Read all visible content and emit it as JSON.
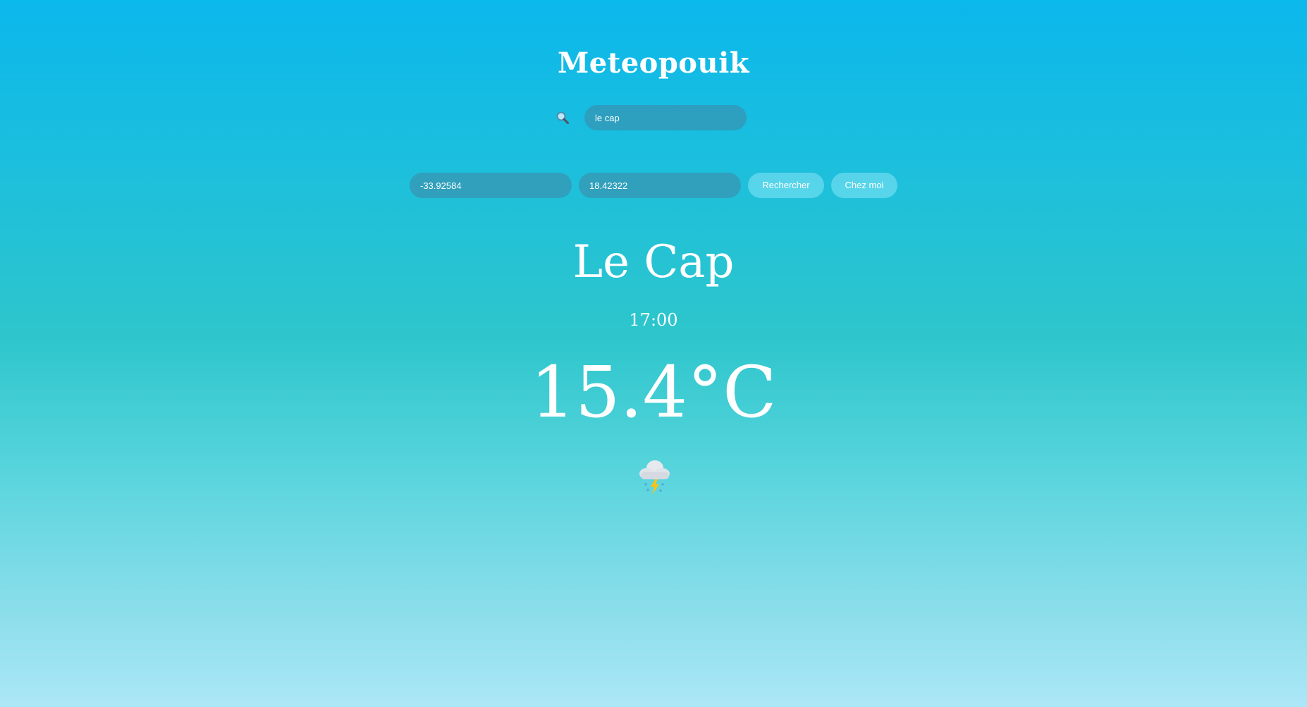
{
  "app": {
    "title": "Meteopouik"
  },
  "search": {
    "city_value": "le cap",
    "icon": "search-icon"
  },
  "coordinates": {
    "latitude": "-33.92584",
    "longitude": "18.42322"
  },
  "buttons": {
    "search_label": "Rechercher",
    "home_label": "Chez moi"
  },
  "weather": {
    "city": "Le Cap",
    "time": "17:00",
    "temperature": "15.4°C",
    "icon": "thunderstorm-snow-cloud-icon"
  },
  "colors": {
    "background_top": "#0bb8ec",
    "background_mid": "#2ec6cc",
    "background_bottom": "#ace7f7",
    "input_bg": "#3c8caa",
    "button_bg": "#6edcf0",
    "text": "#ffffff"
  }
}
